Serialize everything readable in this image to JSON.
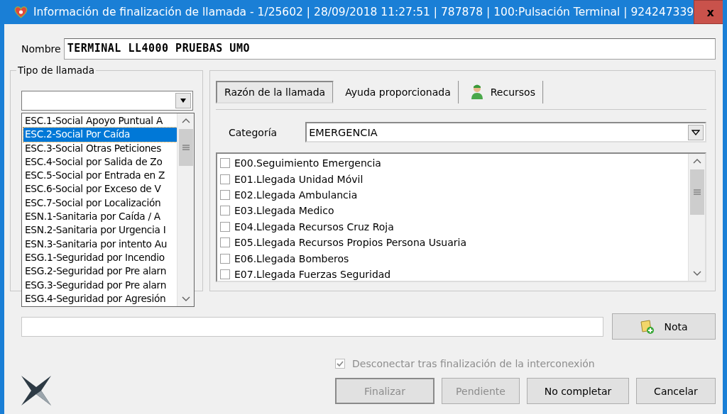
{
  "window": {
    "title": "Información de finalización de llamada - 1/25602 | 28/09/2018 11:27:51 | 787878 | 100:Pulsación Terminal | 924247339",
    "close": "x"
  },
  "name_field": {
    "label": "Nombre",
    "value": "TERMINAL LL4000 PRUEBAS UMO"
  },
  "call_type": {
    "label": "Tipo de llamada",
    "options": [
      {
        "label": "ESC.1-Social Apoyo Puntual A",
        "selected": false
      },
      {
        "label": "ESC.2-Social Por Caída",
        "selected": true
      },
      {
        "label": "ESC.3-Social Otras Peticiones",
        "selected": false
      },
      {
        "label": "ESC.4-Social por Salida de Zo",
        "selected": false
      },
      {
        "label": "ESC.5-Social por Entrada en Z",
        "selected": false
      },
      {
        "label": "ESC.6-Social por Exceso de V",
        "selected": false
      },
      {
        "label": "ESC.7-Social por Localización",
        "selected": false
      },
      {
        "label": "ESN.1-Sanitaria por Caída / A",
        "selected": false
      },
      {
        "label": "ESN.2-Sanitaria por Urgencia I",
        "selected": false
      },
      {
        "label": "ESN.3-Sanitaria por intento Au",
        "selected": false
      },
      {
        "label": "ESG.1-Seguridad por Incendio",
        "selected": false
      },
      {
        "label": "ESG.2-Seguridad por Pre alarn",
        "selected": false
      },
      {
        "label": "ESG.3-Seguridad por Pre alarn",
        "selected": false
      },
      {
        "label": "ESG.4-Seguridad por Agresión",
        "selected": false
      }
    ]
  },
  "tabs": [
    {
      "label": "Razón de la llamada",
      "selected": true,
      "kind": "plain"
    },
    {
      "label": "Ayuda proporcionada",
      "selected": false,
      "kind": "plain"
    },
    {
      "label": "Recursos",
      "selected": false,
      "kind": "icon"
    }
  ],
  "category": {
    "label": "Categoría",
    "value": "EMERGENCIA"
  },
  "reasons": [
    {
      "label": "E00.Seguimiento Emergencia",
      "checked": false
    },
    {
      "label": "E01.Llegada Unidad Móvil",
      "checked": false
    },
    {
      "label": "E02.Llegada Ambulancia",
      "checked": false
    },
    {
      "label": "E03.Llegada Medico",
      "checked": false
    },
    {
      "label": "E04.Llegada Recursos Cruz Roja",
      "checked": false
    },
    {
      "label": "E05.Llegada Recursos Propios Persona Usuaria",
      "checked": false
    },
    {
      "label": "E06.Llegada Bomberos",
      "checked": false
    },
    {
      "label": "E07.Llegada Fuerzas Seguridad",
      "checked": false
    }
  ],
  "note_button": {
    "label": "Nota"
  },
  "disconnect": {
    "label": "Desconectar tras finalización de la interconexión",
    "checked": true,
    "disabled": true
  },
  "buttons": [
    {
      "label": "Finalizar",
      "disabled": true,
      "default": true
    },
    {
      "label": "Pendiente",
      "disabled": true,
      "default": false
    },
    {
      "label": "No completar",
      "disabled": false,
      "default": false
    },
    {
      "label": "Cancelar",
      "disabled": false,
      "default": false
    }
  ]
}
